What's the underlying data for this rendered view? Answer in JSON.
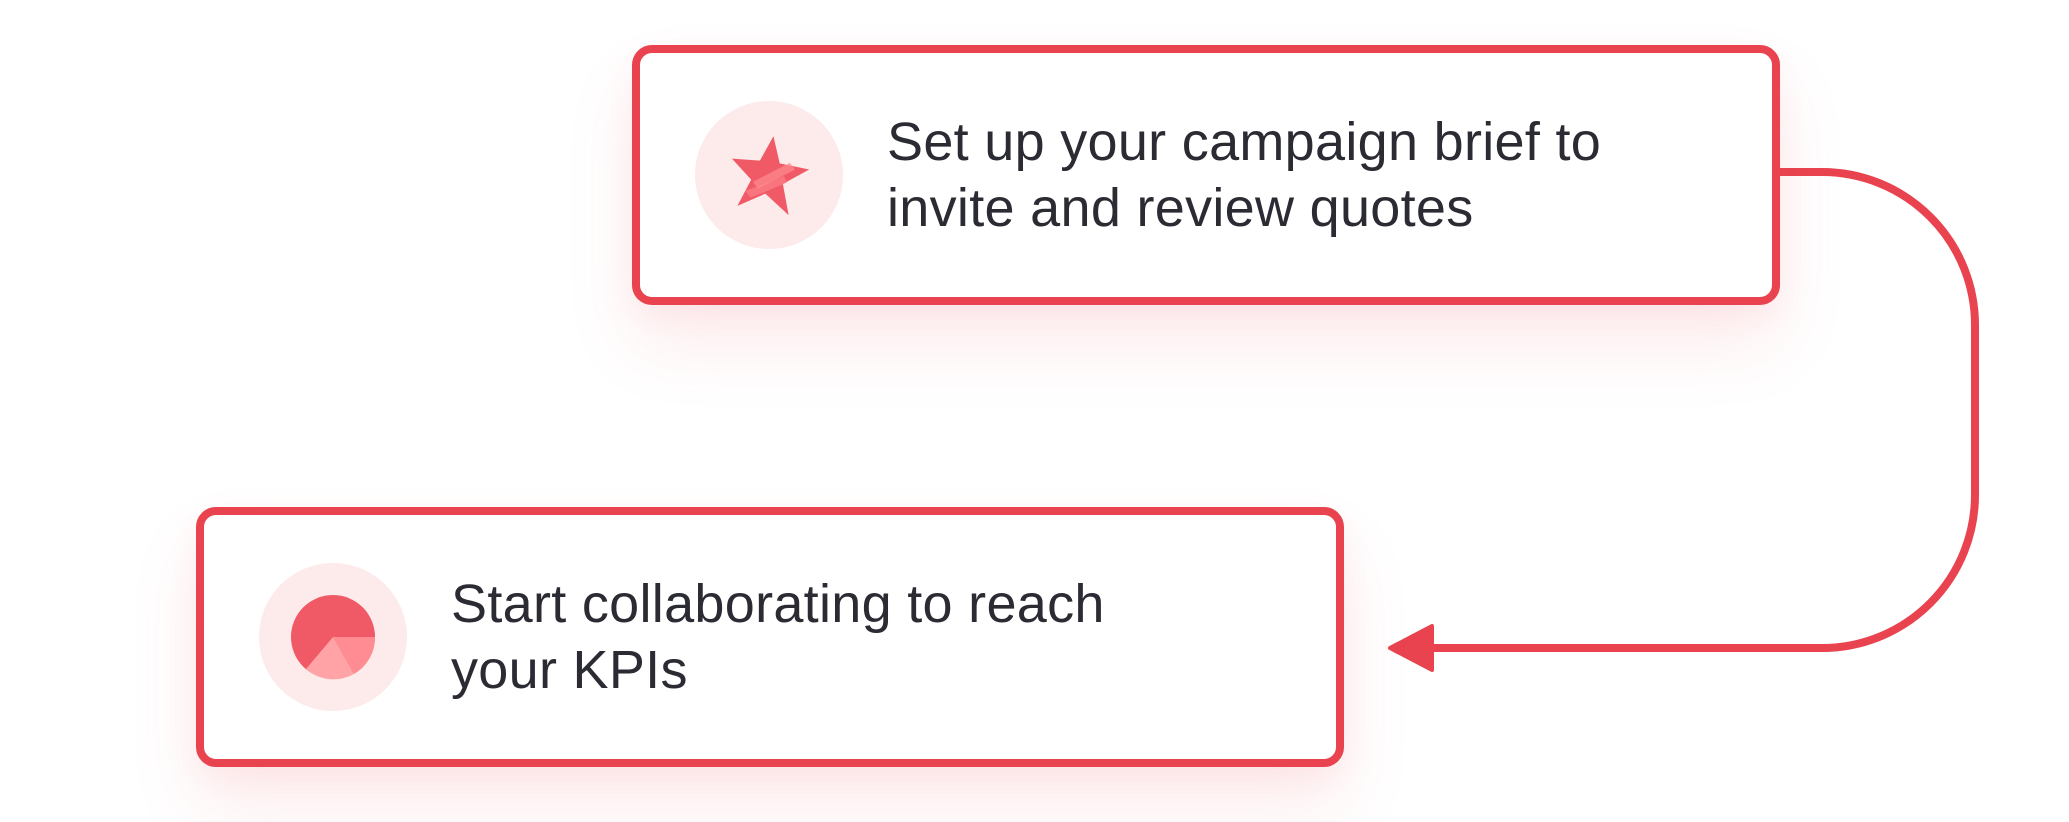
{
  "steps": [
    {
      "icon": "star-icon",
      "text_line1": "Set up your campaign brief to",
      "text_line2": "invite and review quotes"
    },
    {
      "icon": "pie-chart-icon",
      "text_line1": "Start collaborating to reach",
      "text_line2": "your KPIs"
    }
  ],
  "connector": {
    "from": "step-1",
    "to": "step-2",
    "style": "arrow"
  },
  "colors": {
    "accent": "#e8434f",
    "icon_background": "#fdeaea",
    "text": "#2b2b33",
    "icon_fill": "#ef5a66",
    "icon_fill_light": "#ffa3a6"
  }
}
